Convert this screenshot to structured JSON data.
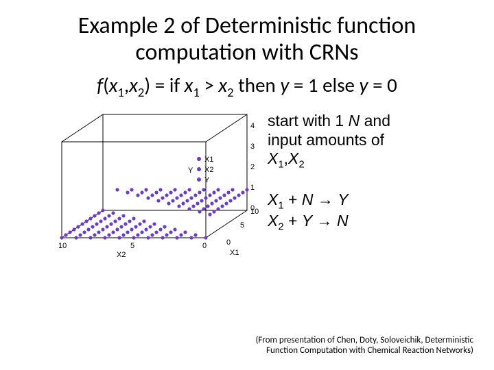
{
  "title_line1": "Example 2 of Deterministic function",
  "title_line2": "computation with CRNs",
  "formula": {
    "f": "f",
    "open": "(",
    "x1": "x",
    "s1": "1",
    "comma": ",",
    "x2": "x",
    "s2": "2",
    "close": ") = if ",
    "x1b": "x",
    "s1b": "1",
    "gt": " > ",
    "x2b": "x",
    "s2b": "2",
    "then": " then ",
    "y": "y",
    "eq1": " = 1 else ",
    "y2": "y",
    "eq0": " = 0"
  },
  "rhs": {
    "l1a": "start with 1 ",
    "l1N": "N",
    "l1b": " and",
    "l2": "input amounts of",
    "l3X1": "X",
    "l3s1": "1",
    "l3c": ",",
    "l3X2": "X",
    "l3s2": "2",
    "r1X": "X",
    "r1s": "1",
    "r1p": " + ",
    "r1N": "N",
    "r1a": " → ",
    "r1Y": "Y",
    "r2X": "X",
    "r2s": "2",
    "r2p": " + ",
    "r2Y": "Y",
    "r2a": " → ",
    "r2N": "N"
  },
  "plot": {
    "x1_label": "X1",
    "x2_label": "X2",
    "y_label": "Y",
    "x1_ticks": [
      "0",
      "5",
      "10"
    ],
    "x2_ticks": [
      "0",
      "5",
      "10"
    ],
    "y_ticks": [
      "0",
      "1",
      "2",
      "3",
      "4"
    ],
    "legend": [
      "X1",
      "X2",
      "Y"
    ]
  },
  "citation_l1": "(From presentation of Chen, Doty, Soloveichik, Deterministic",
  "citation_l2": "Function Computation with Chemical Reaction Networks)",
  "chart_data": {
    "type": "scatter",
    "title": "",
    "axes": {
      "x1": {
        "label": "X1",
        "range": [
          0,
          10
        ],
        "ticks": [
          0,
          5,
          10
        ]
      },
      "x2": {
        "label": "X2",
        "range": [
          0,
          10
        ],
        "ticks": [
          0,
          5,
          10
        ]
      },
      "y": {
        "label": "Y",
        "range": [
          0,
          4
        ],
        "ticks": [
          0,
          1,
          2,
          3,
          4
        ]
      }
    },
    "legend": [
      "X1",
      "X2",
      "Y"
    ],
    "series": [
      {
        "name": "Y",
        "points_rule": "for integer x1 in 0..10 and x2 in 0..10: y = 1 if x1 > x2 else 0",
        "grid_x1": [
          0,
          1,
          2,
          3,
          4,
          5,
          6,
          7,
          8,
          9,
          10
        ],
        "grid_x2": [
          0,
          1,
          2,
          3,
          4,
          5,
          6,
          7,
          8,
          9,
          10
        ]
      }
    ]
  }
}
